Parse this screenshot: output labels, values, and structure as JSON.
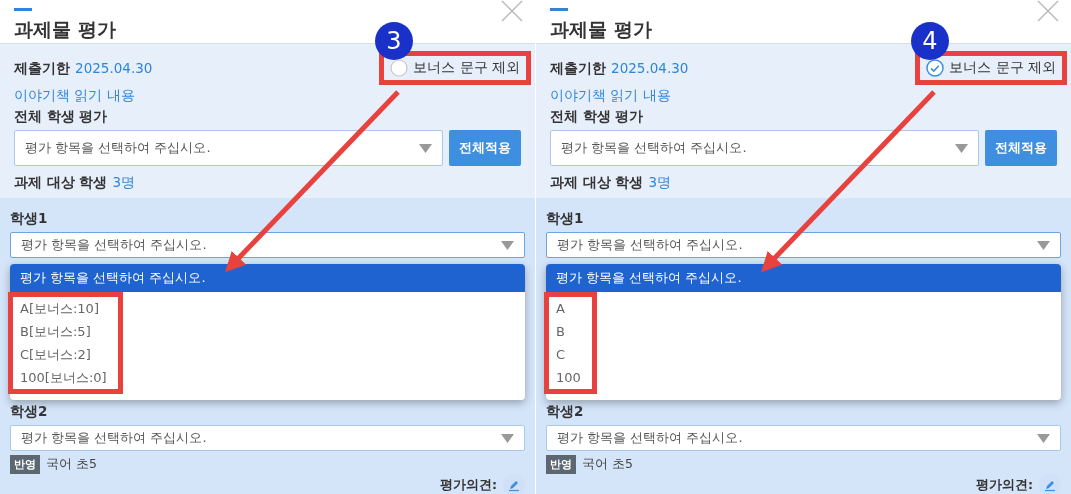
{
  "panels": [
    {
      "title": "과제물 평가",
      "step": "3",
      "deadline_label": "제출기한",
      "deadline": "2025.04.30",
      "exclude_bonus": {
        "label": "보너스 문구 제외",
        "checked": false
      },
      "link": "이야기책 읽기 내용",
      "all_eval": {
        "label": "전체 학생 평가",
        "value": "평가 항목을 선택하여 주십시오.",
        "button": "전체적용"
      },
      "targets": {
        "label": "과제 대상 학생",
        "count": "3명"
      },
      "students": [
        {
          "name": "학생1",
          "value": "평가 항목을 선택하여 주십시오.",
          "expanded": true,
          "options": [
            {
              "label": "평가 항목을 선택하여 주십시오.",
              "selected": true
            },
            {
              "label": "A[보너스:10]",
              "selected": false
            },
            {
              "label": "B[보너스:5]",
              "selected": false
            },
            {
              "label": "C[보너스:2]",
              "selected": false
            },
            {
              "label": "100[보너스:0]",
              "selected": false
            }
          ]
        },
        {
          "name": "학생2",
          "value": "평가 항목을 선택하여 주십시오.",
          "expanded": false,
          "tag": "반영",
          "subject": "국어 초5",
          "comment_label": "평가의견:"
        }
      ]
    },
    {
      "title": "과제물 평가",
      "step": "4",
      "deadline_label": "제출기한",
      "deadline": "2025.04.30",
      "exclude_bonus": {
        "label": "보너스 문구 제외",
        "checked": true
      },
      "link": "이야기책 읽기 내용",
      "all_eval": {
        "label": "전체 학생 평가",
        "value": "평가 항목을 선택하여 주십시오.",
        "button": "전체적용"
      },
      "targets": {
        "label": "과제 대상 학생",
        "count": "3명"
      },
      "students": [
        {
          "name": "학생1",
          "value": "평가 항목을 선택하여 주십시오.",
          "expanded": true,
          "options": [
            {
              "label": "평가 항목을 선택하여 주십시오.",
              "selected": true
            },
            {
              "label": "A",
              "selected": false
            },
            {
              "label": "B",
              "selected": false
            },
            {
              "label": "C",
              "selected": false
            },
            {
              "label": "100",
              "selected": false
            }
          ]
        },
        {
          "name": "학생2",
          "value": "평가 항목을 선택하여 주십시오.",
          "expanded": false,
          "tag": "반영",
          "subject": "국어 초5",
          "comment_label": "평가의견:"
        }
      ]
    }
  ]
}
